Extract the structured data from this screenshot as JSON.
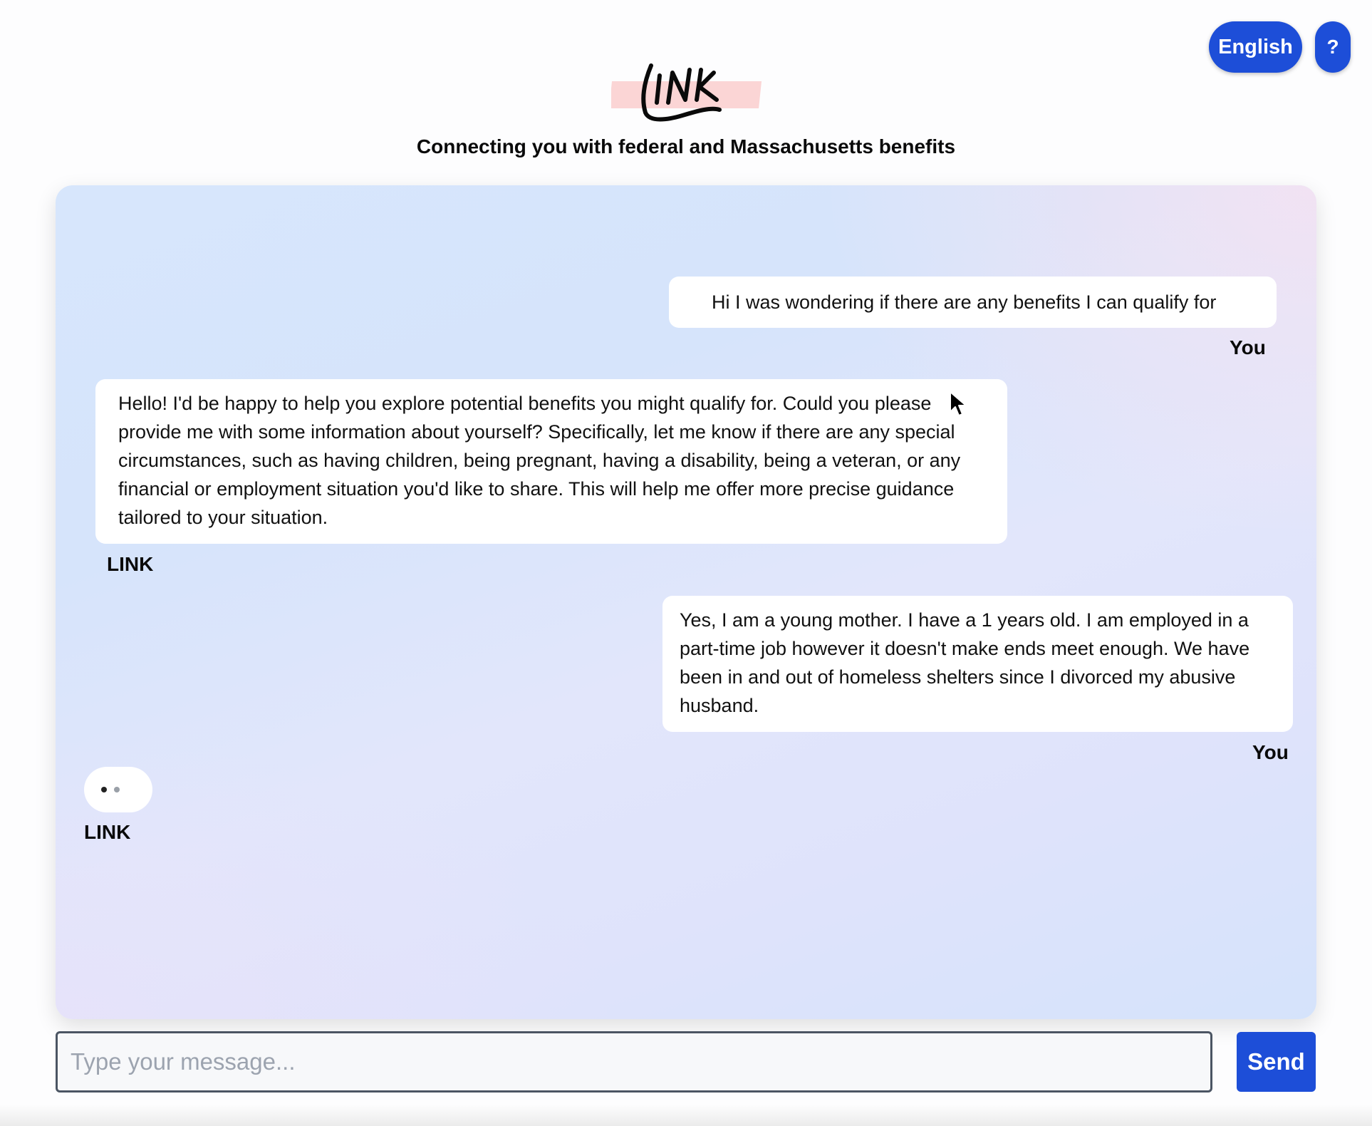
{
  "header": {
    "language_label": "English",
    "help_label": "?",
    "logo_text": "LINK",
    "tagline": "Connecting you with federal and Massachusetts benefits"
  },
  "chat": {
    "messages": [
      {
        "sender": "You",
        "text": "Hi I was wondering if there are any benefits I can qualify for"
      },
      {
        "sender": "LINK",
        "text": "Hello! I'd be happy to help you explore potential benefits you might qualify for. Could you please provide me with some information about yourself? Specifically, let me know if there are any special circumstances, such as having children, being pregnant, having a disability, being a veteran, or any financial or employment situation you'd like to share. This will help me offer more precise guidance tailored to your situation."
      },
      {
        "sender": "You",
        "text": "Yes, I am a young mother. I have a 1 years old. I am employed in a part-time job however it doesn't make ends meet enough. We have been in and out of homeless shelters since I divorced my abusive husband."
      }
    ],
    "typing_sender": "LINK"
  },
  "composer": {
    "placeholder": "Type your message...",
    "value": "",
    "send_label": "Send"
  },
  "colors": {
    "accent": "#1d4ed8",
    "logo_highlight": "#fbd5d5"
  }
}
